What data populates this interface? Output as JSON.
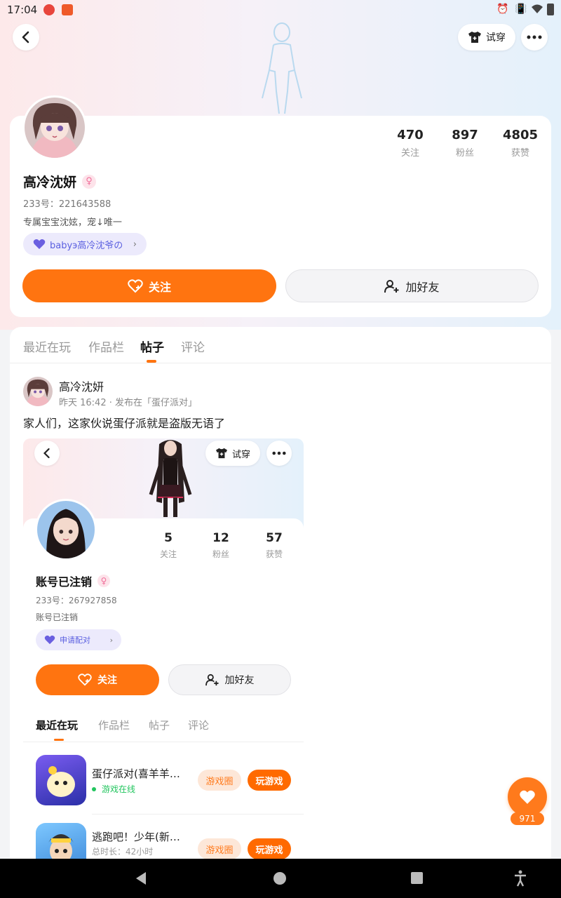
{
  "status": {
    "time": "17:04"
  },
  "header": {
    "try_on_label": "试穿"
  },
  "profile": {
    "stats": [
      {
        "value": "470",
        "label": "关注"
      },
      {
        "value": "897",
        "label": "粉丝"
      },
      {
        "value": "4805",
        "label": "获赞"
      }
    ],
    "name": "高冷沈妍",
    "gender_symbol": "♀",
    "id_text": "233号：221643588",
    "bio": "专属宝宝沈妶，宠↓唯一",
    "pair_chip": "babyэ高冷沈爷の",
    "follow_label": "关注",
    "add_friend_label": "加好友"
  },
  "tabs": [
    {
      "label": "最近在玩"
    },
    {
      "label": "作品栏"
    },
    {
      "label": "帖子"
    },
    {
      "label": "评论"
    }
  ],
  "post": {
    "author": "高冷沈妍",
    "meta": "昨天 16:42 · 发布在「蛋仔派对」",
    "text": "家人们，这家伙说蛋仔派就是盗版无语了",
    "screenshot": {
      "try_on_label": "试穿",
      "stats": [
        {
          "value": "5",
          "label": "关注"
        },
        {
          "value": "12",
          "label": "粉丝"
        },
        {
          "value": "57",
          "label": "获赞"
        }
      ],
      "name": "账号已注销",
      "id_text": "233号：267927858",
      "bio": "账号已注销",
      "pair_chip": "申请配对",
      "follow_label": "关注",
      "add_friend_label": "加好友",
      "tabs": [
        {
          "label": "最近在玩"
        },
        {
          "label": "作品栏"
        },
        {
          "label": "帖子"
        },
        {
          "label": "评论"
        }
      ],
      "games": [
        {
          "title": "蛋仔派对(喜羊羊…",
          "sub": "游戏在线",
          "circle_label": "游戏圈",
          "play_label": "玩游戏"
        },
        {
          "title": "逃跑吧！少年(新…",
          "sub": "总时长：42小时",
          "circle_label": "游戏圈",
          "play_label": "玩游戏"
        }
      ]
    }
  },
  "fab": {
    "count": "971"
  },
  "colors": {
    "accent": "#ff7410",
    "pair": "#5a5fe0",
    "online": "#22c55e"
  }
}
